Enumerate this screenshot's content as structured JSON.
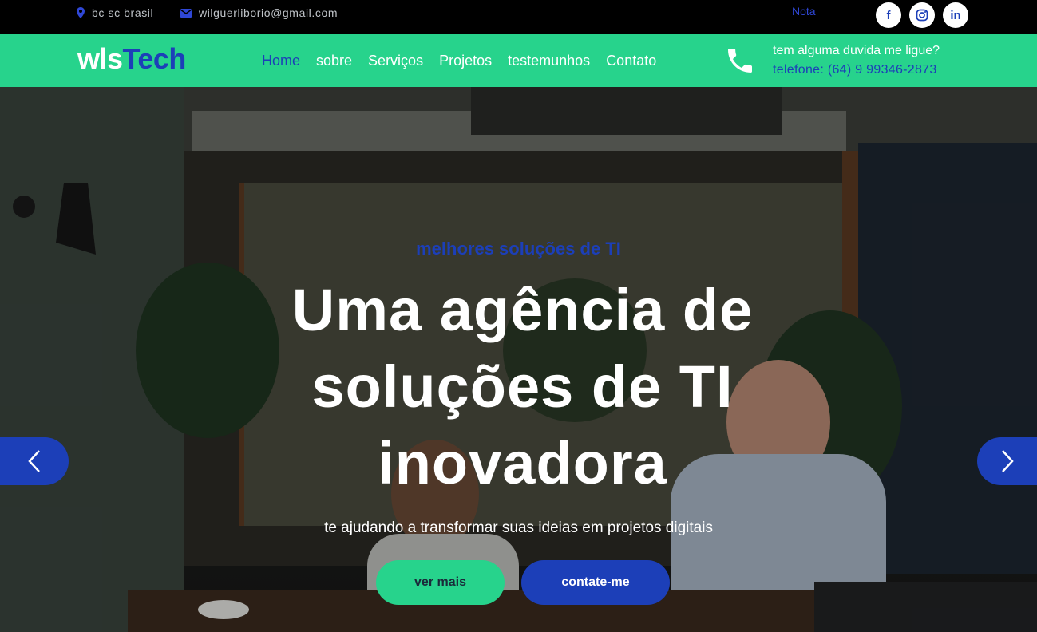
{
  "topbar": {
    "location": "bc sc brasil",
    "email": "wilguerliborio@gmail.com",
    "nota": "Nota",
    "social": {
      "facebook": "f",
      "instagram": "◎",
      "linkedin": "in"
    }
  },
  "navbar": {
    "logo_part1": "wls",
    "logo_part2": "Tech",
    "links": [
      "Home",
      "sobre",
      "Serviços",
      "Projetos",
      "testemunhos",
      "Contato"
    ],
    "call_question": "tem alguma duvida me ligue?",
    "call_number": "telefone: (64) 9 99346-2873"
  },
  "hero": {
    "eyebrow": "melhores soluções de TI",
    "headline": "Uma agência de soluções de TI inovadora",
    "subtitle": "te ajudando a transformar suas ideias em projetos digitais",
    "btn_ver_mais": "ver mais",
    "btn_contate": "contate-me"
  },
  "colors": {
    "accent_green": "#27d38c",
    "accent_blue": "#1c3fb8",
    "topbar_bg": "#000000"
  }
}
